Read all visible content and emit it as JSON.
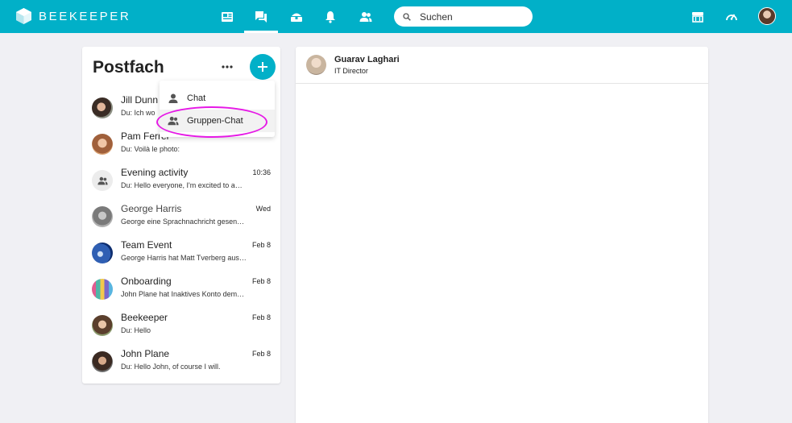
{
  "app": {
    "brand": "BEEKEEPER",
    "accent_color": "#01b0c8",
    "highlight_color": "#e619e6"
  },
  "nav": {
    "items": [
      {
        "icon": "newsfeed-icon"
      },
      {
        "icon": "chat-bubbles-icon",
        "active": true
      },
      {
        "icon": "apps-icon"
      },
      {
        "icon": "bell-icon"
      },
      {
        "icon": "people-icon"
      }
    ],
    "search": {
      "placeholder": "Suchen"
    },
    "right": [
      {
        "icon": "store-icon"
      },
      {
        "icon": "dashboard-gauge-icon"
      },
      {
        "icon": "user-avatar"
      }
    ]
  },
  "inbox": {
    "title": "Postfach",
    "conversations": [
      {
        "name": "Jill Dunn",
        "time": "",
        "preview": "Du: Ich wo",
        "avatar": "person-avatar"
      },
      {
        "name": "Pam Ferrer",
        "time": "",
        "preview": "Du: Voilà le photo:",
        "avatar": "person-avatar"
      },
      {
        "name": "Evening activity",
        "time": "10:36",
        "preview": "Du: Hello everyone, I'm excited to a…",
        "avatar": "group-icon"
      },
      {
        "name": "George Harris",
        "time": "Wed",
        "preview": "George eine Sprachnachricht gesen…",
        "avatar": "person-avatar"
      },
      {
        "name": "Team Event",
        "time": "Feb 8",
        "preview": "George Harris hat Matt Tverberg aus…",
        "avatar": "group-avatar"
      },
      {
        "name": "Onboarding",
        "time": "Feb 8",
        "preview": "John Plane hat Inaktives Konto dem…",
        "avatar": "group-avatar"
      },
      {
        "name": "Beekeeper",
        "time": "Feb 8",
        "preview": "Du: Hello",
        "avatar": "person-avatar"
      },
      {
        "name": "John Plane",
        "time": "Feb 8",
        "preview": "Du: Hello John, of course I will.",
        "avatar": "person-avatar"
      }
    ]
  },
  "dropdown": {
    "items": [
      {
        "label": "Chat",
        "icon": "person-icon"
      },
      {
        "label": "Gruppen-Chat",
        "icon": "group-icon",
        "hover": true
      }
    ]
  },
  "chat": {
    "contact_name": "Guarav Laghari",
    "contact_role": "IT Director"
  }
}
